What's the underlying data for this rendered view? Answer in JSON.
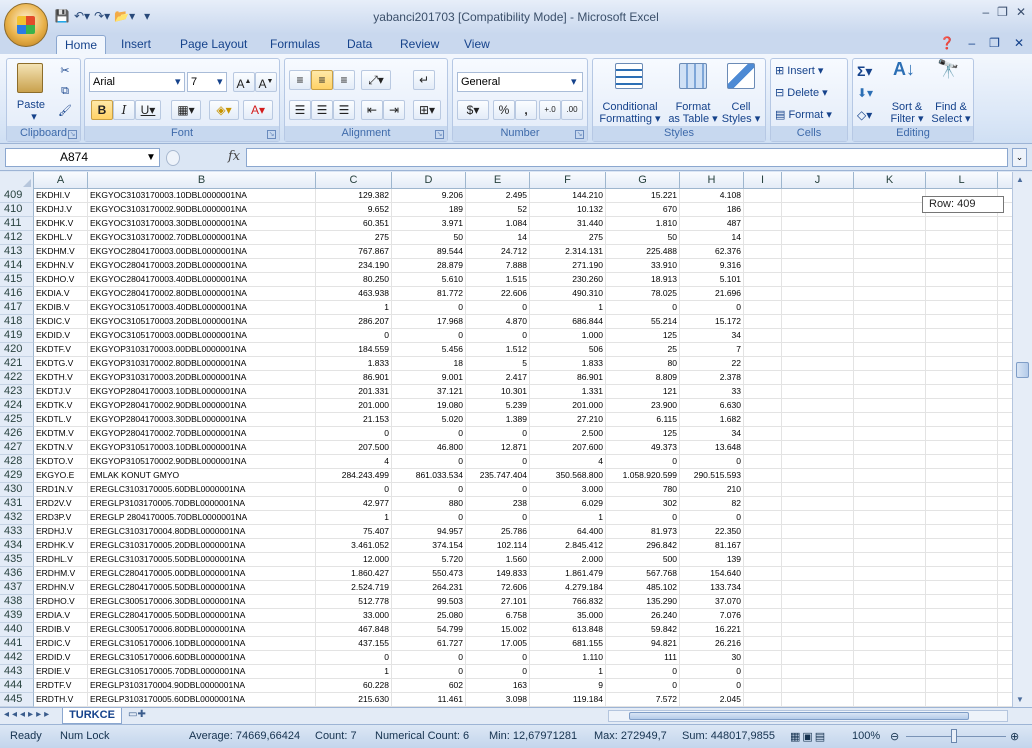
{
  "window": {
    "title": "yabanci201703  [Compatibility Mode] - Microsoft Excel"
  },
  "quick_access": [
    "save",
    "undo",
    "redo",
    "open"
  ],
  "tabs": [
    "Home",
    "Insert",
    "Page Layout",
    "Formulas",
    "Data",
    "Review",
    "View"
  ],
  "active_tab": "Home",
  "ribbon": {
    "clipboard": {
      "label": "Clipboard",
      "paste": "Paste"
    },
    "font": {
      "label": "Font",
      "name": "Arial",
      "size": "7"
    },
    "alignment": {
      "label": "Alignment"
    },
    "number": {
      "label": "Number",
      "format": "General",
      "percent": "%",
      "comma": ","
    },
    "styles": {
      "label": "Styles",
      "conditional": "Conditional",
      "conditional2": "Formatting",
      "format_table": "Format",
      "format_table2": "as Table",
      "cell_styles": "Cell",
      "cell_styles2": "Styles"
    },
    "cells": {
      "label": "Cells",
      "insert": "Insert",
      "delete": "Delete",
      "format": "Format"
    },
    "editing": {
      "label": "Editing",
      "sort": "Sort &",
      "sort2": "Filter",
      "find": "Find &",
      "find2": "Select"
    }
  },
  "formula_bar": {
    "name_box": "A874",
    "fx": "fx",
    "formula": ""
  },
  "columns": [
    "A",
    "B",
    "C",
    "D",
    "E",
    "F",
    "G",
    "H",
    "I",
    "J",
    "K",
    "L"
  ],
  "row_tip": "Row: 409",
  "rows": [
    [
      "409",
      "EKDHI.V",
      "EKGYOC3103170003.10DBL0000001NA",
      "129.382",
      "9.206",
      "2.495",
      "144.210",
      "15.221",
      "4.108"
    ],
    [
      "410",
      "EKDHJ.V",
      "EKGYOC3103170002.90DBL0000001NA",
      "9.652",
      "189",
      "52",
      "10.132",
      "670",
      "186"
    ],
    [
      "411",
      "EKDHK.V",
      "EKGYOC3103170003.30DBL0000001NA",
      "60.351",
      "3.971",
      "1.084",
      "31.440",
      "1.810",
      "487"
    ],
    [
      "412",
      "EKDHL.V",
      "EKGYOC3103170002.70DBL0000001NA",
      "275",
      "50",
      "14",
      "275",
      "50",
      "14"
    ],
    [
      "413",
      "EKDHM.V",
      "EKGYOC2804170003.00DBL0000001NA",
      "767.867",
      "89.544",
      "24.712",
      "2.314.131",
      "225.488",
      "62.376"
    ],
    [
      "414",
      "EKDHN.V",
      "EKGYOC2804170003.20DBL0000001NA",
      "234.190",
      "28.879",
      "7.888",
      "271.190",
      "33.910",
      "9.316"
    ],
    [
      "415",
      "EKDHO.V",
      "EKGYOC2804170003.40DBL0000001NA",
      "80.250",
      "5.610",
      "1.515",
      "230.260",
      "18.913",
      "5.101"
    ],
    [
      "416",
      "EKDIA.V",
      "EKGYOC2804170002.80DBL0000001NA",
      "463.938",
      "81.772",
      "22.606",
      "490.310",
      "78.025",
      "21.696"
    ],
    [
      "417",
      "EKDIB.V",
      "EKGYOC3105170003.40DBL0000001NA",
      "1",
      "0",
      "0",
      "1",
      "0",
      "0"
    ],
    [
      "418",
      "EKDIC.V",
      "EKGYOC3105170003.20DBL0000001NA",
      "286.207",
      "17.968",
      "4.870",
      "686.844",
      "55.214",
      "15.172"
    ],
    [
      "419",
      "EKDID.V",
      "EKGYOC3105170003.00DBL0000001NA",
      "0",
      "0",
      "0",
      "1.000",
      "125",
      "34"
    ],
    [
      "420",
      "EKDTF.V",
      "EKGYOP3103170003.00DBL0000001NA",
      "184.559",
      "5.456",
      "1.512",
      "506",
      "25",
      "7"
    ],
    [
      "421",
      "EKDTG.V",
      "EKGYOP3103170002.80DBL0000001NA",
      "1.833",
      "18",
      "5",
      "1.833",
      "80",
      "22"
    ],
    [
      "422",
      "EKDTH.V",
      "EKGYOP3103170003.20DBL0000001NA",
      "86.901",
      "9.001",
      "2.417",
      "86.901",
      "8.809",
      "2.378"
    ],
    [
      "423",
      "EKDTJ.V",
      "EKGYOP2804170003.10DBL0000001NA",
      "201.331",
      "37.121",
      "10.301",
      "1.331",
      "121",
      "33"
    ],
    [
      "424",
      "EKDTK.V",
      "EKGYOP2804170002.90DBL0000001NA",
      "201.000",
      "19.080",
      "5.239",
      "201.000",
      "23.900",
      "6.630"
    ],
    [
      "425",
      "EKDTL.V",
      "EKGYOP2804170003.30DBL0000001NA",
      "21.153",
      "5.020",
      "1.389",
      "27.210",
      "6.115",
      "1.682"
    ],
    [
      "426",
      "EKDTM.V",
      "EKGYOP2804170002.70DBL0000001NA",
      "0",
      "0",
      "0",
      "2.500",
      "125",
      "34"
    ],
    [
      "427",
      "EKDTN.V",
      "EKGYOP3105170003.10DBL0000001NA",
      "207.500",
      "46.800",
      "12.871",
      "207.600",
      "49.373",
      "13.648"
    ],
    [
      "428",
      "EKDTO.V",
      "EKGYOP3105170002.90DBL0000001NA",
      "4",
      "0",
      "0",
      "4",
      "0",
      "0"
    ],
    [
      "429",
      "EKGYO.E",
      "EMLAK KONUT GMYO",
      "284.243.499",
      "861.033.534",
      "235.747.404",
      "350.568.800",
      "1.058.920.599",
      "290.515.593"
    ],
    [
      "430",
      "ERD1N.V",
      "EREGLC3103170005.60DBL0000001NA",
      "0",
      "0",
      "0",
      "3.000",
      "780",
      "210"
    ],
    [
      "431",
      "ERD2V.V",
      "EREGLP3103170005.70DBL0000001NA",
      "42.977",
      "880",
      "238",
      "6.029",
      "302",
      "82"
    ],
    [
      "432",
      "ERD3P.V",
      "EREGLP 2804170005.70DBL0000001NA",
      "1",
      "0",
      "0",
      "1",
      "0",
      "0"
    ],
    [
      "433",
      "ERDHJ.V",
      "EREGLC3103170004.80DBL0000001NA",
      "75.407",
      "94.957",
      "25.786",
      "64.400",
      "81.973",
      "22.350"
    ],
    [
      "434",
      "ERDHK.V",
      "EREGLC3103170005.20DBL0000001NA",
      "3.461.052",
      "374.154",
      "102.114",
      "2.845.412",
      "296.842",
      "81.167"
    ],
    [
      "435",
      "ERDHL.V",
      "EREGLC3103170005.50DBL0000001NA",
      "12.000",
      "5.720",
      "1.560",
      "2.000",
      "500",
      "139"
    ],
    [
      "436",
      "ERDHM.V",
      "EREGLC2804170005.00DBL0000001NA",
      "1.860.427",
      "550.473",
      "149.833",
      "1.861.479",
      "567.768",
      "154.640"
    ],
    [
      "437",
      "ERDHN.V",
      "EREGLC2804170005.50DBL0000001NA",
      "2.524.719",
      "264.231",
      "72.606",
      "4.279.184",
      "485.102",
      "133.734"
    ],
    [
      "438",
      "ERDHO.V",
      "EREGLC3005170006.30DBL0000001NA",
      "512.778",
      "99.503",
      "27.101",
      "766.832",
      "135.290",
      "37.070"
    ],
    [
      "439",
      "ERDIA.V",
      "EREGLC2804170005.50DBL0000001NA",
      "33.000",
      "25.080",
      "6.758",
      "35.000",
      "26.240",
      "7.076"
    ],
    [
      "440",
      "ERDIB.V",
      "EREGLC3005170006.80DBL0000001NA",
      "467.848",
      "54.799",
      "15.002",
      "613.848",
      "59.842",
      "16.221"
    ],
    [
      "441",
      "ERDIC.V",
      "EREGLC3105170006.10DBL0000001NA",
      "437.155",
      "61.727",
      "17.005",
      "681.155",
      "94.821",
      "26.216"
    ],
    [
      "442",
      "ERDID.V",
      "EREGLC3105170006.60DBL0000001NA",
      "0",
      "0",
      "0",
      "1.110",
      "111",
      "30"
    ],
    [
      "443",
      "ERDIE.V",
      "EREGLC3105170005.70DBL0000001NA",
      "1",
      "0",
      "0",
      "1",
      "0",
      "0"
    ],
    [
      "444",
      "ERDTF.V",
      "EREGLP3103170004.90DBL0000001NA",
      "60.228",
      "602",
      "163",
      "9",
      "0",
      "0"
    ],
    [
      "445",
      "ERDTH.V",
      "EREGLP3103170005.60DBL0000001NA",
      "215.630",
      "11.461",
      "3.098",
      "119.184",
      "7.572",
      "2.045"
    ]
  ],
  "sheet": {
    "name": "TURKCE"
  },
  "status": {
    "ready": "Ready",
    "num_lock": "Num Lock",
    "average": "Average: 74669,66424",
    "count": "Count: 7",
    "numerical_count": "Numerical Count: 6",
    "min": "Min: 12,67971281",
    "max": "Max: 272949,7",
    "sum": "Sum: 448017,9855",
    "zoom": "100%"
  }
}
